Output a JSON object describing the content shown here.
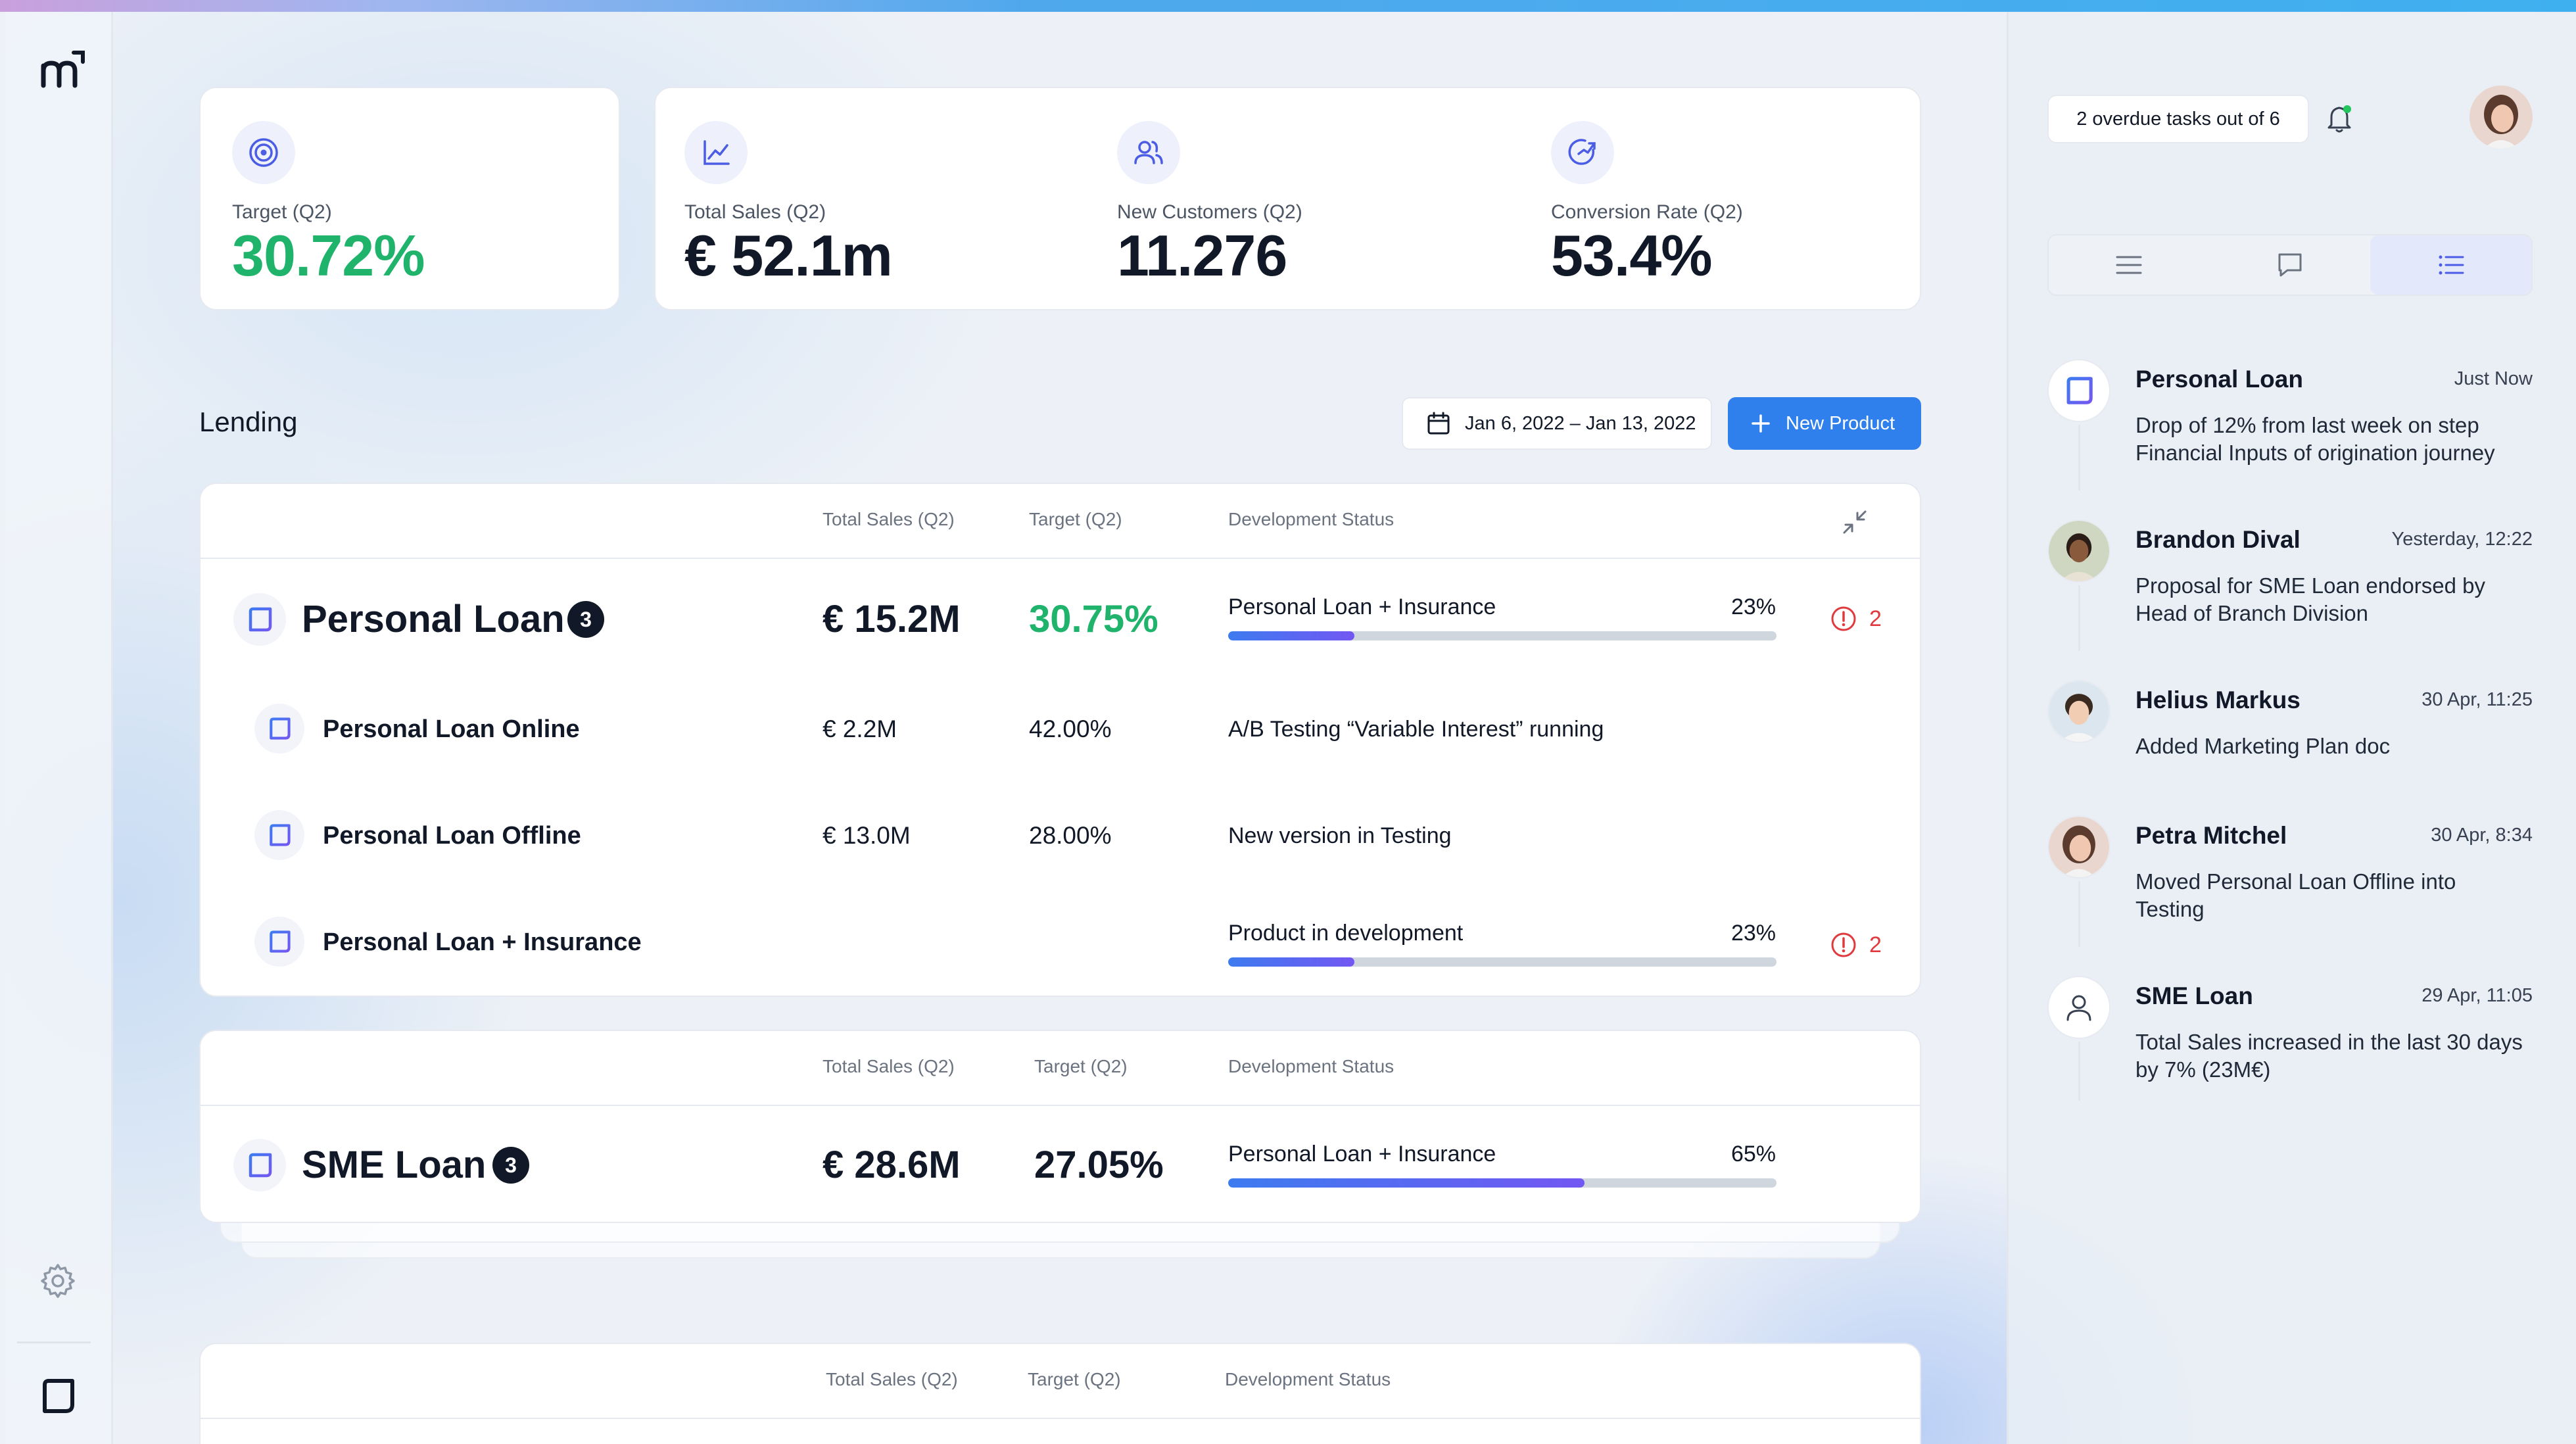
{
  "app": {
    "logo": "m-logo"
  },
  "stats": [
    {
      "label": "Target (Q2)",
      "value": "30.72%",
      "icon": "target-icon",
      "accent": "#1fb36b"
    },
    {
      "label": "Total Sales (Q2)",
      "value": "€ 52.1m",
      "icon": "line-chart-icon"
    },
    {
      "label": "New Customers (Q2)",
      "value": "11.276",
      "icon": "users-icon"
    },
    {
      "label": "Conversion Rate (Q2)",
      "value": "53.4%",
      "icon": "conversion-icon"
    }
  ],
  "lending": {
    "title": "Lending",
    "date_range": "Jan 6, 2022 – Jan 13, 2022",
    "new_product_label": "New Product",
    "headers": {
      "total_sales": "Total Sales (Q2)",
      "target": "Target (Q2)",
      "status": "Development Status"
    },
    "personal_loan": {
      "name": "Personal Loan",
      "count": "3",
      "total_sales": "€ 15.2M",
      "target": "30.75%",
      "status": "Personal Loan + Insurance",
      "progress_pct": "23%",
      "progress": 0.23,
      "alerts": "2",
      "children": [
        {
          "name": "Personal Loan Online",
          "total_sales": "€ 2.2M",
          "target": "42.00%",
          "status": "A/B Testing “Variable Interest” running"
        },
        {
          "name": "Personal Loan Offline",
          "total_sales": "€ 13.0M",
          "target": "28.00%",
          "status": "New version in Testing"
        },
        {
          "name": "Personal Loan + Insurance",
          "status": "Product in development",
          "progress_pct": "23%",
          "progress": 0.23,
          "alerts": "2"
        }
      ]
    },
    "sme_loan": {
      "name": "SME Loan",
      "count": "3",
      "total_sales": "€ 28.6M",
      "target": "27.05%",
      "status": "Personal Loan + Insurance",
      "progress_pct": "65%",
      "progress": 0.65
    }
  },
  "right_panel": {
    "overdue": "2 overdue tasks out of 6",
    "tabs": [
      "text-lines-icon",
      "chat-icon",
      "list-icon"
    ],
    "feed": [
      {
        "name": "Personal Loan",
        "time": "Just Now",
        "text": "Drop of 12% from last week on step Financial Inputs of origination journey"
      },
      {
        "name": "Brandon Dival",
        "time": "Yesterday, 12:22",
        "text": "Proposal for SME Loan endorsed by Head of Branch Division"
      },
      {
        "name": "Helius Markus",
        "time": "30 Apr, 11:25",
        "text": "Added Marketing Plan doc"
      },
      {
        "name": "Petra Mitchel",
        "time": "30 Apr, 8:34",
        "text": "Moved Personal Loan Offline into Testing"
      },
      {
        "name": "SME Loan",
        "time": "29 Apr, 11:05",
        "text": "Total Sales increased in the last 30 days by 7% (23M€)"
      }
    ]
  }
}
